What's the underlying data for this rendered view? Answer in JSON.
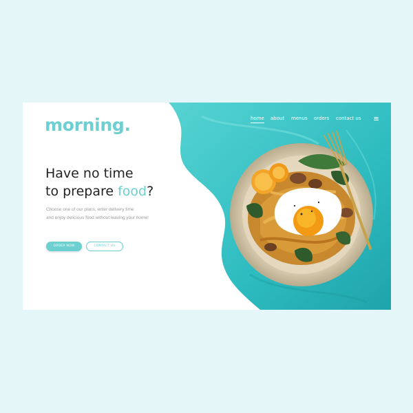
{
  "brand": {
    "logo": "morning.",
    "accent_color": "#6dcfd0",
    "background_color": "#e4f6f7",
    "blob_color": "#3cc3c6"
  },
  "nav": {
    "items": [
      {
        "label": "home",
        "active": true
      },
      {
        "label": "about",
        "active": false
      },
      {
        "label": "menus",
        "active": false
      },
      {
        "label": "orders",
        "active": false
      },
      {
        "label": "contact us",
        "active": false
      }
    ],
    "menu_icon": "hamburger-menu-icon"
  },
  "hero": {
    "headline_line1": "Have no time",
    "headline_line2_prefix": "to prepare ",
    "headline_accent": "food",
    "headline_suffix": "?",
    "subtext_line1": "Choose one of our plans, enter delivery time",
    "subtext_line2": "and enjoy delicious food without leaving your home!",
    "order_button": "ORDER NOW",
    "contact_button": "CONTACT US"
  },
  "image": {
    "description_icon": "food-plate-image"
  }
}
